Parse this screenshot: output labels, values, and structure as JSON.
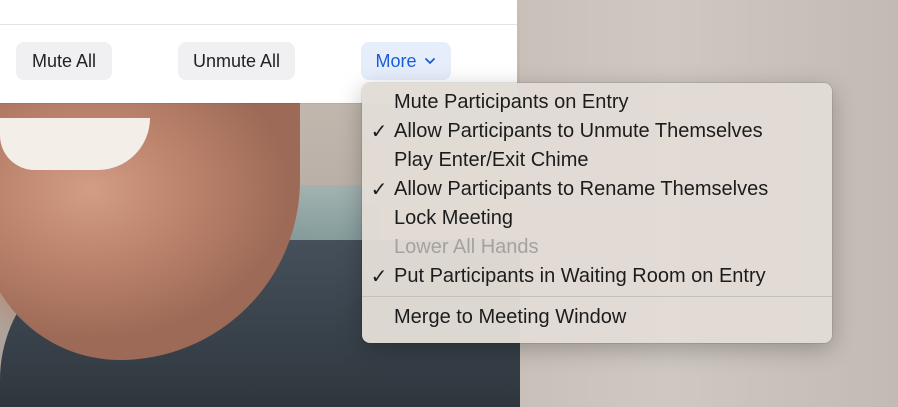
{
  "panel": {
    "buttons": {
      "mute_all": "Mute All",
      "unmute_all": "Unmute All",
      "more": "More"
    }
  },
  "menu": {
    "items": [
      {
        "label": "Mute Participants on Entry",
        "checked": false,
        "enabled": true
      },
      {
        "label": "Allow Participants to Unmute Themselves",
        "checked": true,
        "enabled": true
      },
      {
        "label": "Play Enter/Exit Chime",
        "checked": false,
        "enabled": true
      },
      {
        "label": "Allow Participants to Rename Themselves",
        "checked": true,
        "enabled": true
      },
      {
        "label": "Lock Meeting",
        "checked": false,
        "enabled": true
      },
      {
        "label": "Lower All Hands",
        "checked": false,
        "enabled": false
      },
      {
        "label": "Put Participants in Waiting Room on Entry",
        "checked": true,
        "enabled": true
      }
    ],
    "footer_item": {
      "label": "Merge to Meeting Window"
    },
    "check_glyph": "✓"
  },
  "colors": {
    "accent": "#1a5dd8",
    "menu_bg": "#e2dcd6",
    "disabled_text": "#a5a19c"
  },
  "icons": {
    "more_chevron": "chevron-down-icon",
    "check": "checkmark-icon"
  }
}
